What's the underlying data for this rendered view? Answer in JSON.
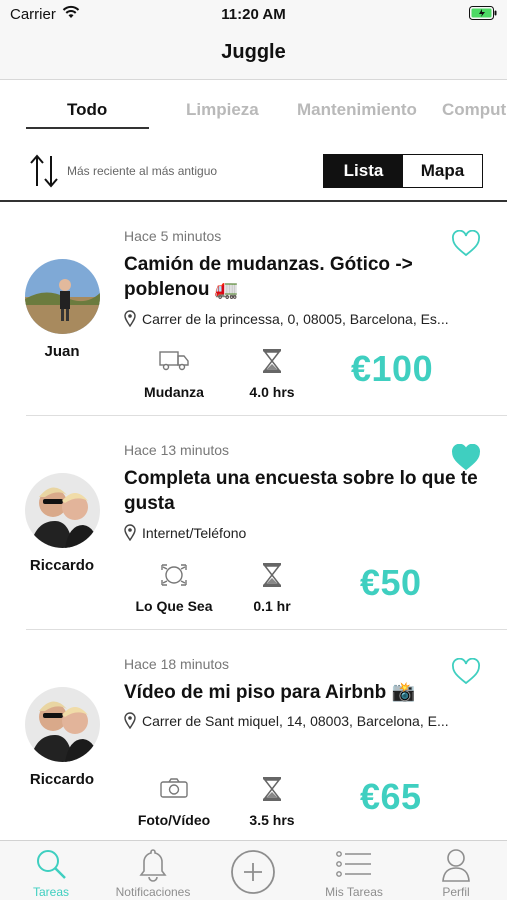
{
  "status_bar": {
    "carrier": "Carrier",
    "time": "11:20 AM"
  },
  "nav": {
    "title": "Juggle"
  },
  "tabs": [
    {
      "label": "Todo",
      "active": true
    },
    {
      "label": "Limpieza",
      "active": false
    },
    {
      "label": "Mantenimiento",
      "active": false
    },
    {
      "label": "Comput",
      "active": false
    }
  ],
  "sort": {
    "label": "Más reciente al más antiguo",
    "view_list": "Lista",
    "view_map": "Mapa",
    "selected": "Lista"
  },
  "tasks": [
    {
      "time_ago": "Hace 5 minutos",
      "title": "Camión de mudanzas. Gótico -> poblenou 🚛",
      "location": "Carrer de la princessa, 0, 08005, Barcelona, Es...",
      "user": "Juan",
      "category": "Mudanza",
      "category_icon": "truck-icon",
      "duration": "4.0 hrs",
      "price": "€100",
      "favorited": false
    },
    {
      "time_ago": "Hace 13 minutos",
      "title": "Completa una encuesta sobre lo que te gusta",
      "location": "Internet/Teléfono",
      "user": "Riccardo",
      "category": "Lo Que Sea",
      "category_icon": "any-task-icon",
      "duration": "0.1 hr",
      "price": "€50",
      "favorited": true
    },
    {
      "time_ago": "Hace 18 minutos",
      "title": "Vídeo de mi piso para Airbnb 📸",
      "location": "Carrer de Sant miquel, 14, 08003, Barcelona, E...",
      "user": "Riccardo",
      "category": "Foto/Vídeo",
      "category_icon": "camera-icon",
      "duration": "3.5 hrs",
      "price": "€65",
      "favorited": false
    }
  ],
  "tab_bar": [
    {
      "label": "Tareas",
      "icon": "search-icon",
      "active": true
    },
    {
      "label": "Notificaciones",
      "icon": "bell-icon",
      "active": false
    },
    {
      "label": "",
      "icon": "add-icon",
      "active": false
    },
    {
      "label": "Mis Tareas",
      "icon": "list-icon",
      "active": false
    },
    {
      "label": "Perfil",
      "icon": "profile-icon",
      "active": false
    }
  ],
  "colors": {
    "accent": "#3fcfc0",
    "text": "#111111",
    "muted": "#b9b9b9"
  }
}
